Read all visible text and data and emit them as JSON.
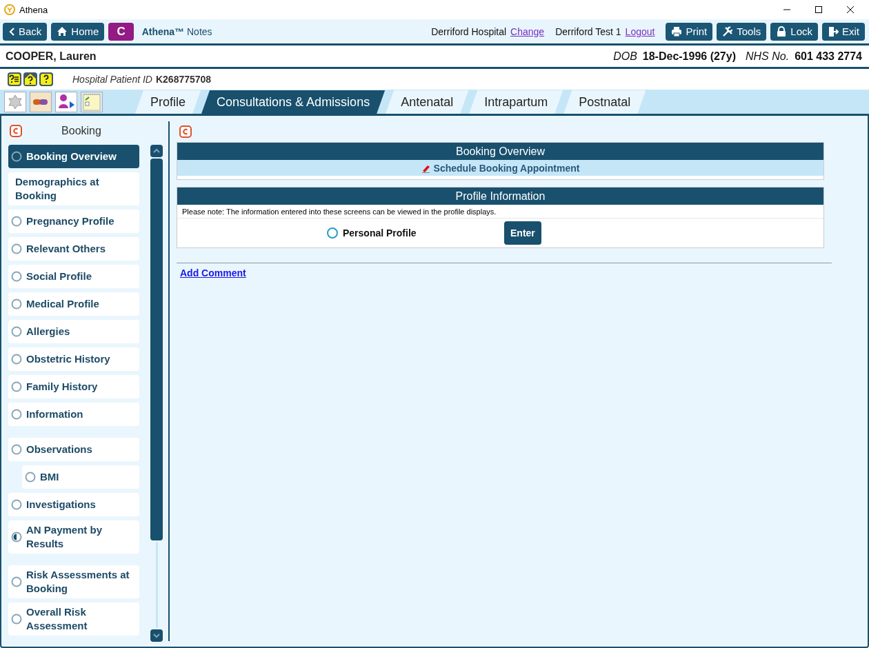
{
  "window": {
    "title": "Athena"
  },
  "toolbar": {
    "nav": [
      {
        "kind": "back",
        "label": "Back"
      },
      {
        "kind": "home",
        "label": "Home"
      },
      {
        "kind": "c",
        "label": "C"
      }
    ],
    "app_title": "**Athena™** Notes",
    "location": "Derriford Hospital",
    "location_link": "Change",
    "user": "Derriford Test 1",
    "user_link": "Logout",
    "actions": [
      {
        "kind": "print",
        "label": "Print"
      },
      {
        "kind": "tools",
        "label": "Tools"
      },
      {
        "kind": "lock",
        "label": "Lock"
      },
      {
        "kind": "exit",
        "label": "Exit"
      }
    ]
  },
  "patient": {
    "name": "COOPER, Lauren",
    "dob_label": "DOB",
    "dob": "18-Dec-1996 (27y)",
    "nhs_label": "NHS No.",
    "nhs": "601 433 2774",
    "id_label": "Hospital Patient ID",
    "id": "K268775708"
  },
  "tabs": [
    {
      "label": "Profile",
      "selected": false
    },
    {
      "label": "Consultations & Admissions",
      "selected": true
    },
    {
      "label": "Antenatal",
      "selected": false
    },
    {
      "label": "Intrapartum",
      "selected": false
    },
    {
      "label": "Postnatal",
      "selected": false
    }
  ],
  "sidebar": {
    "title": "Booking",
    "groups": [
      [
        {
          "label": "Booking Overview",
          "kind": "circle",
          "selected": true
        },
        {
          "label": "Demographics at Booking",
          "kind": "plain",
          "selected": false
        },
        {
          "label": "Pregnancy Profile",
          "kind": "circle",
          "selected": false
        },
        {
          "label": "Relevant Others",
          "kind": "circle",
          "selected": false
        },
        {
          "label": "Social Profile",
          "kind": "circle",
          "selected": false
        },
        {
          "label": "Medical Profile",
          "kind": "circle",
          "selected": false
        },
        {
          "label": "Allergies",
          "kind": "circle",
          "selected": false
        },
        {
          "label": "Obstetric History",
          "kind": "circle",
          "selected": false
        },
        {
          "label": "Family History",
          "kind": "circle",
          "selected": false
        },
        {
          "label": "Information",
          "kind": "circle",
          "selected": false
        }
      ],
      [
        {
          "label": "Observations",
          "kind": "circle",
          "selected": false,
          "children": [
            {
              "label": "BMI",
              "kind": "circle",
              "selected": false
            }
          ]
        },
        {
          "label": "Investigations",
          "kind": "circle",
          "selected": false
        },
        {
          "label": "AN Payment by Results",
          "kind": "half",
          "selected": false
        }
      ],
      [
        {
          "label": "Risk Assessments at Booking",
          "kind": "circle",
          "selected": false
        },
        {
          "label": "Overall Risk Assessment",
          "kind": "circle",
          "selected": false
        }
      ]
    ]
  },
  "content": {
    "panels": [
      {
        "kind": "links",
        "title": "Booking Overview",
        "link": "Schedule Booking Appointment"
      },
      {
        "kind": "profile",
        "title": "Profile Information",
        "note": "Please note: The information entered into these screens can be viewed in the profile displays.",
        "option": {
          "label": "Personal Profile",
          "selected": false
        },
        "button": "Enter"
      }
    ],
    "comment_link": "Add Comment"
  }
}
